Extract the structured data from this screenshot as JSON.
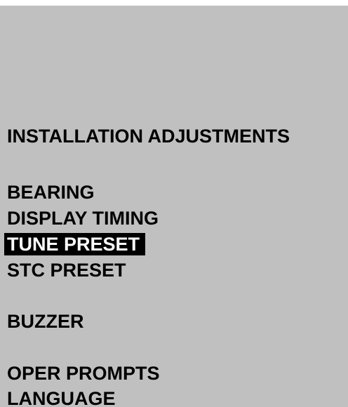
{
  "menu": {
    "title": "INSTALLATION ADJUSTMENTS",
    "items": [
      {
        "label": "BEARING",
        "selected": false
      },
      {
        "label": "DISPLAY TIMING",
        "selected": false
      },
      {
        "label": "TUNE PRESET",
        "selected": true
      },
      {
        "label": "STC PRESET",
        "selected": false
      },
      {
        "label": "BUZZER",
        "selected": false
      },
      {
        "label": "OPER PROMPTS",
        "selected": false
      },
      {
        "label": "LANGUAGE",
        "selected": false
      }
    ]
  },
  "colors": {
    "background": "#c0c0c0",
    "text": "#000000",
    "highlight_background": "#000000",
    "highlight_text": "#ffffff"
  }
}
